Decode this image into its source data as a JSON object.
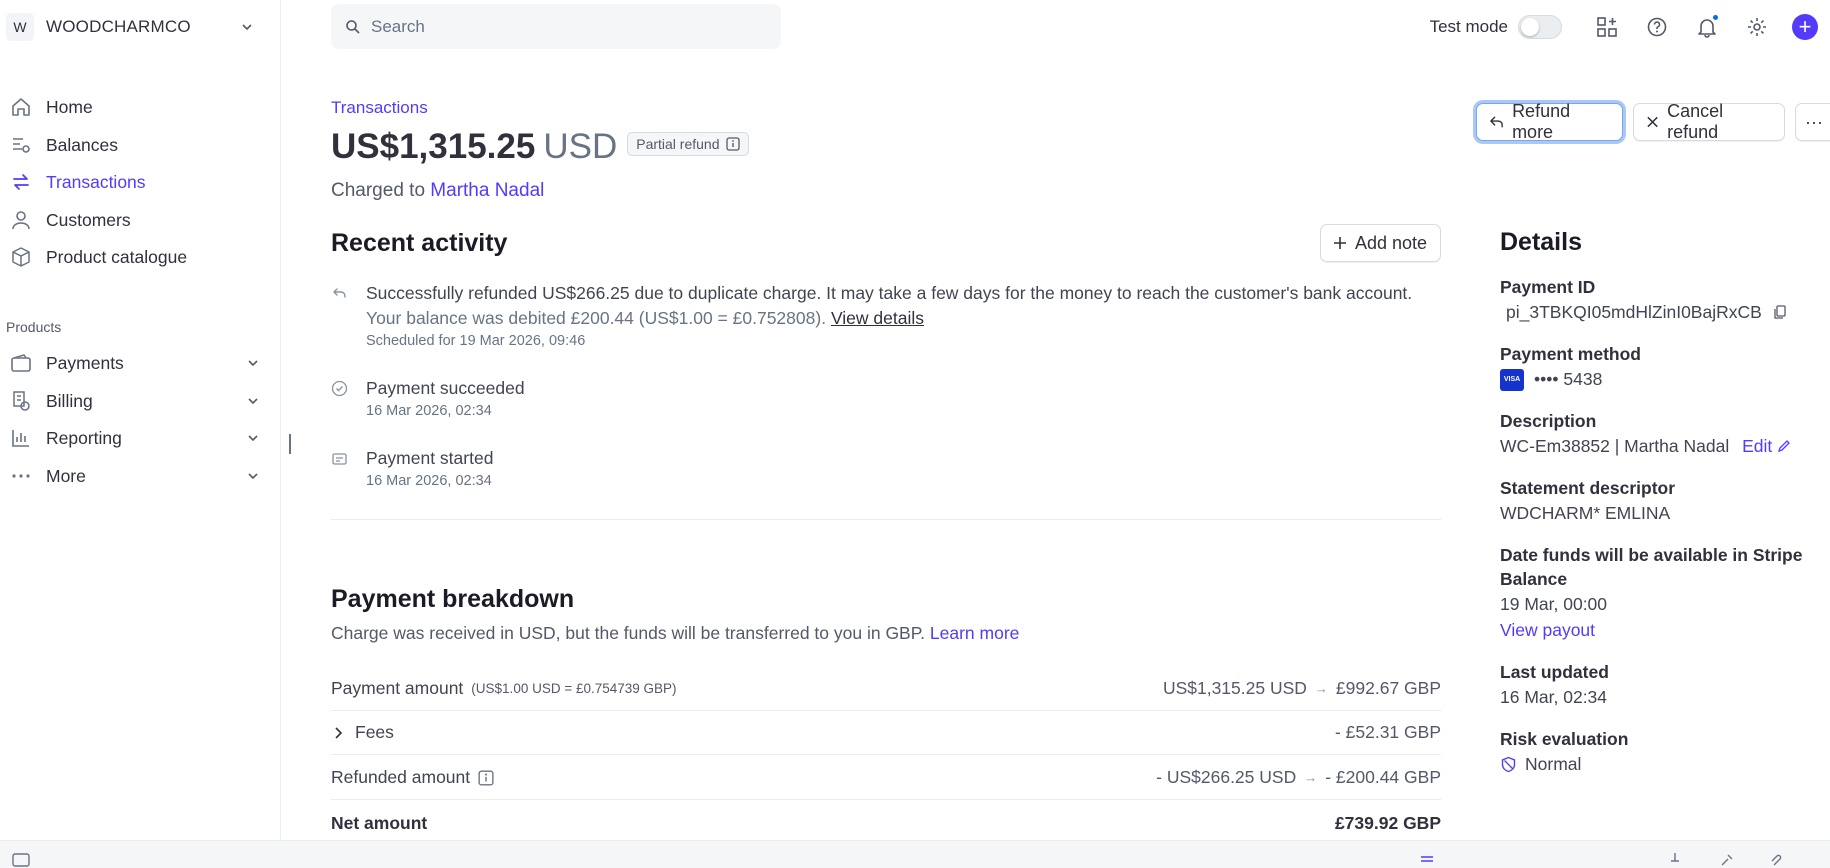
{
  "account": {
    "initial": "W",
    "name": "WOODCHARMCO"
  },
  "sidebar": {
    "items": [
      {
        "label": "Home"
      },
      {
        "label": "Balances"
      },
      {
        "label": "Transactions"
      },
      {
        "label": "Customers"
      },
      {
        "label": "Product catalogue"
      }
    ],
    "products_title": "Products",
    "products": [
      {
        "label": "Payments"
      },
      {
        "label": "Billing"
      },
      {
        "label": "Reporting"
      },
      {
        "label": "More"
      }
    ]
  },
  "topbar": {
    "search_placeholder": "Search",
    "test_mode_label": "Test mode"
  },
  "header": {
    "breadcrumb": "Transactions",
    "amount": "US$1,315.25",
    "currency": "USD",
    "badge": "Partial refund",
    "charged_prefix": "Charged to",
    "customer": "Martha Nadal",
    "refund_more": "Refund more",
    "cancel_refund": "Cancel refund",
    "more": "···"
  },
  "activity": {
    "title": "Recent activity",
    "add_note": "Add note",
    "events": [
      {
        "line1": "Successfully refunded US$266.25 due to duplicate charge. It may take a few days for the money to reach the customer's bank account.",
        "line2": "Your balance was debited £200.44 (US$1.00 = £0.752808).",
        "link": "View details",
        "time": "Scheduled for 19 Mar 2026, 09:46"
      },
      {
        "line1": "Payment succeeded",
        "time": "16 Mar 2026, 02:34"
      },
      {
        "line1": "Payment started",
        "time": "16 Mar 2026, 02:34"
      }
    ]
  },
  "breakdown": {
    "title": "Payment breakdown",
    "subtitle": "Charge was received in USD, but the funds will be transferred to you in GBP.",
    "learn_more": "Learn more",
    "payment_label": "Payment amount",
    "payment_rate": "(US$1.00 USD = £0.754739 GBP)",
    "payment_usd": "US$1,315.25 USD",
    "payment_gbp": "£992.67 GBP",
    "fees_label": "Fees",
    "fees_value": "- £52.31 GBP",
    "refunded_label": "Refunded amount",
    "refunded_usd": "- US$266.25 USD",
    "refunded_gbp": "- £200.44 GBP",
    "net_label": "Net amount",
    "net_value": "£739.92 GBP"
  },
  "details": {
    "title": "Details",
    "payment_id_label": "Payment ID",
    "payment_id": "pi_3TBKQI05mdHlZinI0BajRxCB",
    "payment_method_label": "Payment method",
    "card_brand": "VISA",
    "card_last4": "•••• 5438",
    "description_label": "Description",
    "description": "WC-Em38852 | Martha Nadal",
    "edit": "Edit",
    "statement_label": "Statement descriptor",
    "statement": "WDCHARM* EMLINA",
    "funds_label": "Date funds will be available in Stripe Balance",
    "funds_date": "19 Mar, 00:00",
    "view_payout": "View payout",
    "updated_label": "Last updated",
    "updated": "16 Mar, 02:34",
    "risk_label": "Risk evaluation",
    "risk": "Normal"
  },
  "colors": {
    "accent": "#533afd",
    "text": "#30313d",
    "muted": "#687385"
  }
}
